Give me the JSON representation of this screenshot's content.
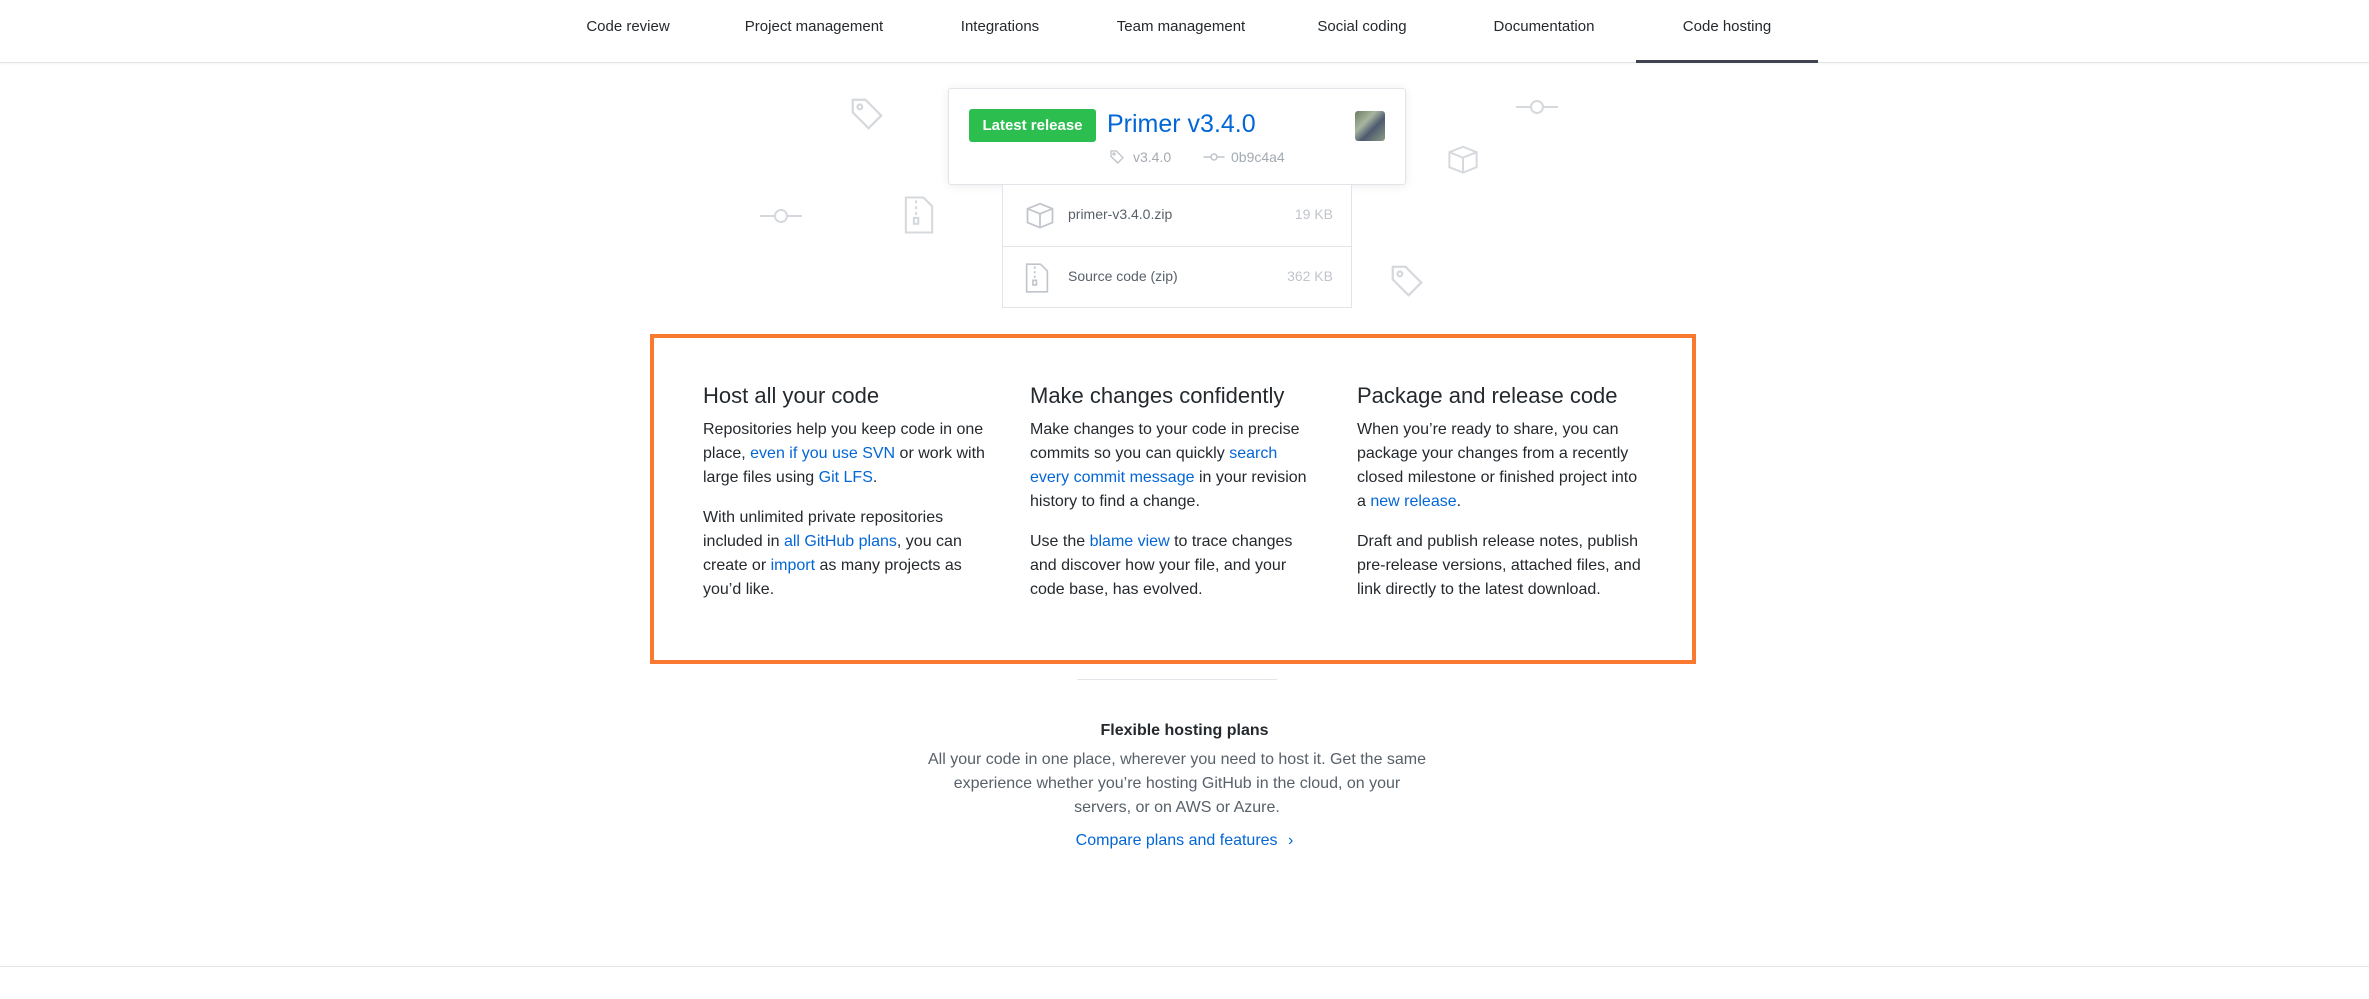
{
  "nav": {
    "items": [
      {
        "label": "Code review"
      },
      {
        "label": "Project management"
      },
      {
        "label": "Integrations"
      },
      {
        "label": "Team management"
      },
      {
        "label": "Social coding"
      },
      {
        "label": "Documentation"
      },
      {
        "label": "Code hosting"
      }
    ],
    "active": "Code hosting"
  },
  "release": {
    "badge": "Latest release",
    "title": "Primer v3.4.0",
    "tag": "v3.4.0",
    "commit": "0b9c4a4",
    "files": [
      {
        "name": "primer-v3.4.0.zip",
        "size": "19 KB",
        "icon": "package-icon"
      },
      {
        "name": "Source code (zip)",
        "size": "362 KB",
        "icon": "file-zip-icon"
      }
    ]
  },
  "features": [
    {
      "title": "Host all your code",
      "p1": {
        "t1": "Repositories help you keep code in one place, ",
        "l1": "even if you use SVN",
        "t2": " or work with large files using ",
        "l2": "Git LFS",
        "t3": "."
      },
      "p2": {
        "t1": "With unlimited private repositories included in ",
        "l1": "all GitHub plans",
        "t2": ", you can create or ",
        "l2": "import",
        "t3": " as many projects as you’d like."
      }
    },
    {
      "title": "Make changes confidently",
      "p1": {
        "t1": "Make changes to your code in precise commits so you can quickly ",
        "l1": "search every commit message",
        "t2": " in your revision history to find a change."
      },
      "p2": {
        "t1": "Use the ",
        "l1": "blame view",
        "t2": " to trace changes and discover how your file, and your code base, has evolved."
      }
    },
    {
      "title": "Package and release code",
      "p1": {
        "t1": "When you’re ready to share, you can package your changes from a recently closed milestone or finished project into a ",
        "l1": "new release",
        "t2": "."
      },
      "p2": {
        "t1": "Draft and publish release notes, publish pre-release versions, attached files, and link directly to the latest download."
      }
    }
  ],
  "plans": {
    "title": "Flexible hosting plans",
    "text": "All your code in one place, wherever you need to host it. Get the same experience whether you’re hosting GitHub in the cloud, on your servers, or on AWS or Azure.",
    "link": "Compare plans and features",
    "link_chevron": "›"
  },
  "colors": {
    "accent_link": "#0366d6",
    "badge_green": "#2cbe4e",
    "highlight_orange": "#f8792f"
  }
}
